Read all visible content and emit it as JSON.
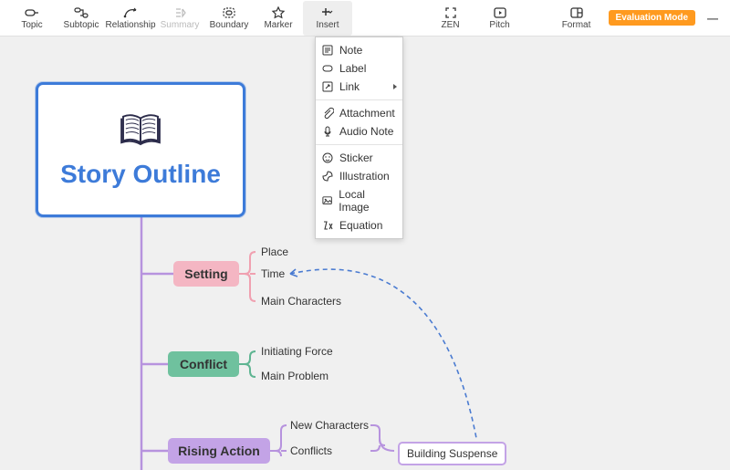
{
  "toolbar": {
    "topic": "Topic",
    "subtopic": "Subtopic",
    "relationship": "Relationship",
    "summary": "Summary",
    "boundary": "Boundary",
    "marker": "Marker",
    "insert": "Insert",
    "zen": "ZEN",
    "pitch": "Pitch",
    "format": "Format",
    "evaluation_badge": "Evaluation Mode"
  },
  "insert_menu": {
    "note": "Note",
    "label": "Label",
    "link": "Link",
    "attachment": "Attachment",
    "audio_note": "Audio Note",
    "sticker": "Sticker",
    "illustration": "Illustration",
    "local_image": "Local Image",
    "equation": "Equation"
  },
  "map": {
    "root": "Story Outline",
    "setting": {
      "label": "Setting",
      "children": {
        "place": "Place",
        "time": "Time",
        "main_characters": "Main Characters"
      }
    },
    "conflict": {
      "label": "Conflict",
      "children": {
        "initiating_force": "Initiating Force",
        "main_problem": "Main Problem"
      }
    },
    "rising_action": {
      "label": "Rising Action",
      "children": {
        "new_characters": "New Characters",
        "conflicts": "Conflicts"
      },
      "leaf": "Building Suspense"
    }
  }
}
